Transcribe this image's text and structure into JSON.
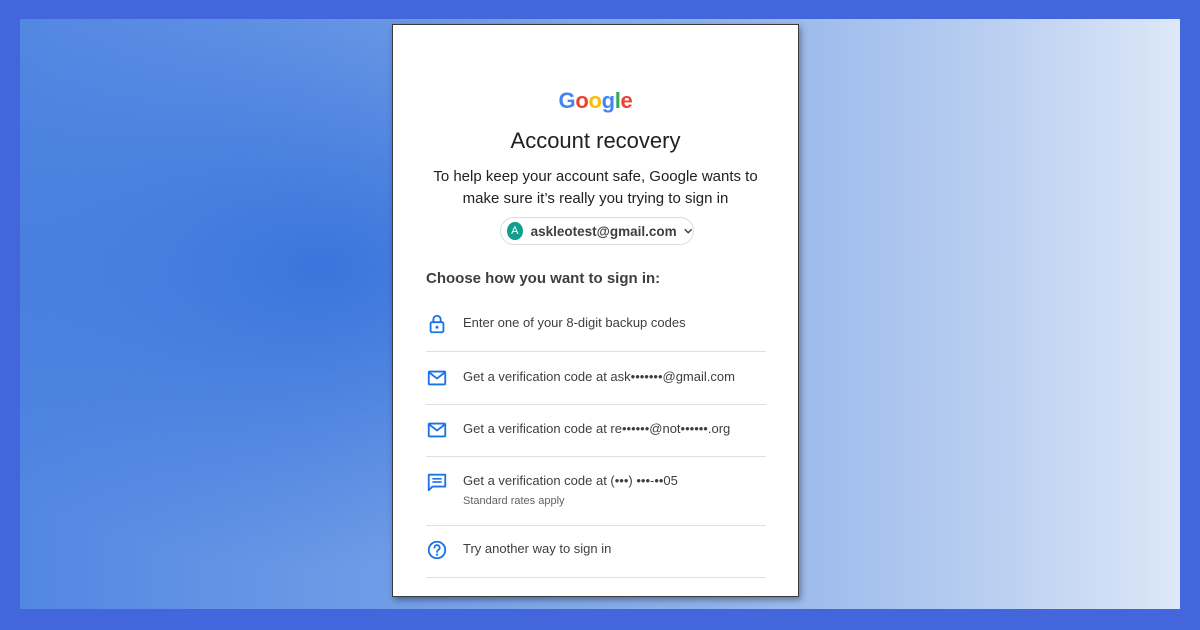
{
  "brand": {
    "logo_letters": [
      "G",
      "o",
      "o",
      "g",
      "l",
      "e"
    ],
    "logo_colors": [
      "#4285F4",
      "#EA4335",
      "#FBBC05",
      "#4285F4",
      "#34A853",
      "#EA4335"
    ],
    "accent": "#1a73e8"
  },
  "page": {
    "title": "Account recovery",
    "subtitle": "To help keep your account safe, Google wants to make sure it’s really you trying to sign in"
  },
  "account": {
    "avatar_letter": "A",
    "email": "askleotest@gmail.com",
    "dropdown_icon": "chevron-down-icon"
  },
  "choose_label": "Choose how you want to sign in:",
  "options": [
    {
      "icon": "lock-icon",
      "label": "Enter one of your 8-digit backup codes"
    },
    {
      "icon": "mail-icon",
      "label": "Get a verification code at ask•••••••@gmail.com"
    },
    {
      "icon": "mail-icon",
      "label": "Get a verification code at re••••••@not••••••.org"
    },
    {
      "icon": "sms-icon",
      "label": "Get a verification code at (•••) •••-••05",
      "sublabel": "Standard rates apply"
    },
    {
      "icon": "help-icon",
      "label": "Try another way to sign in"
    }
  ]
}
